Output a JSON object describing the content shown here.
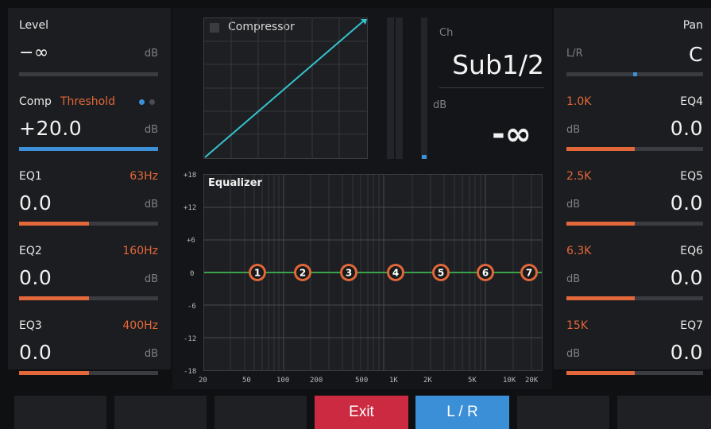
{
  "left": {
    "level": {
      "label": "Level",
      "value": "−∞",
      "unit": "dB"
    },
    "comp": {
      "label": "Comp",
      "threshold_label": "Threshold",
      "value": "+20.0",
      "unit": "dB",
      "fill": 1.0
    },
    "eq": [
      {
        "label": "EQ1",
        "freq": "63Hz",
        "value": "0.0",
        "unit": "dB",
        "fill": 0.5
      },
      {
        "label": "EQ2",
        "freq": "160Hz",
        "value": "0.0",
        "unit": "dB",
        "fill": 0.5
      },
      {
        "label": "EQ3",
        "freq": "400Hz",
        "value": "0.0",
        "unit": "dB",
        "fill": 0.5
      }
    ]
  },
  "right": {
    "pan": {
      "label": "Pan",
      "lr_label": "L/R",
      "value": "C",
      "position": 0.5
    },
    "eq": [
      {
        "label": "EQ4",
        "freq": "1.0K",
        "value": "0.0",
        "unit": "dB",
        "fill": 0.5
      },
      {
        "label": "EQ5",
        "freq": "2.5K",
        "value": "0.0",
        "unit": "dB",
        "fill": 0.5
      },
      {
        "label": "EQ6",
        "freq": "6.3K",
        "value": "0.0",
        "unit": "dB",
        "fill": 0.5
      },
      {
        "label": "EQ7",
        "freq": "15K",
        "value": "0.0",
        "unit": "dB",
        "fill": 0.5
      }
    ]
  },
  "compressor": {
    "title": "Compressor"
  },
  "channel": {
    "ch_label": "Ch",
    "name": "Sub1/2",
    "db_label": "dB",
    "db_value": "-∞"
  },
  "equalizer": {
    "title": "Equalizer",
    "y_ticks": [
      "+18",
      "+12",
      "+6",
      "0",
      "-6",
      "-12",
      "-18"
    ],
    "x_ticks": [
      "20",
      "50",
      "100",
      "200",
      "500",
      "1K",
      "2K",
      "5K",
      "10K",
      "20K"
    ],
    "bands": [
      "1",
      "2",
      "3",
      "4",
      "5",
      "6",
      "7"
    ]
  },
  "buttons": {
    "exit": "Exit",
    "lr": "L / R"
  },
  "colors": {
    "accent_orange": "#e2673a",
    "accent_blue": "#3d8fd8",
    "exit_red": "#cb2a40",
    "trace_cyan": "#35c3cf",
    "eq_line_green": "#3ca24a"
  }
}
